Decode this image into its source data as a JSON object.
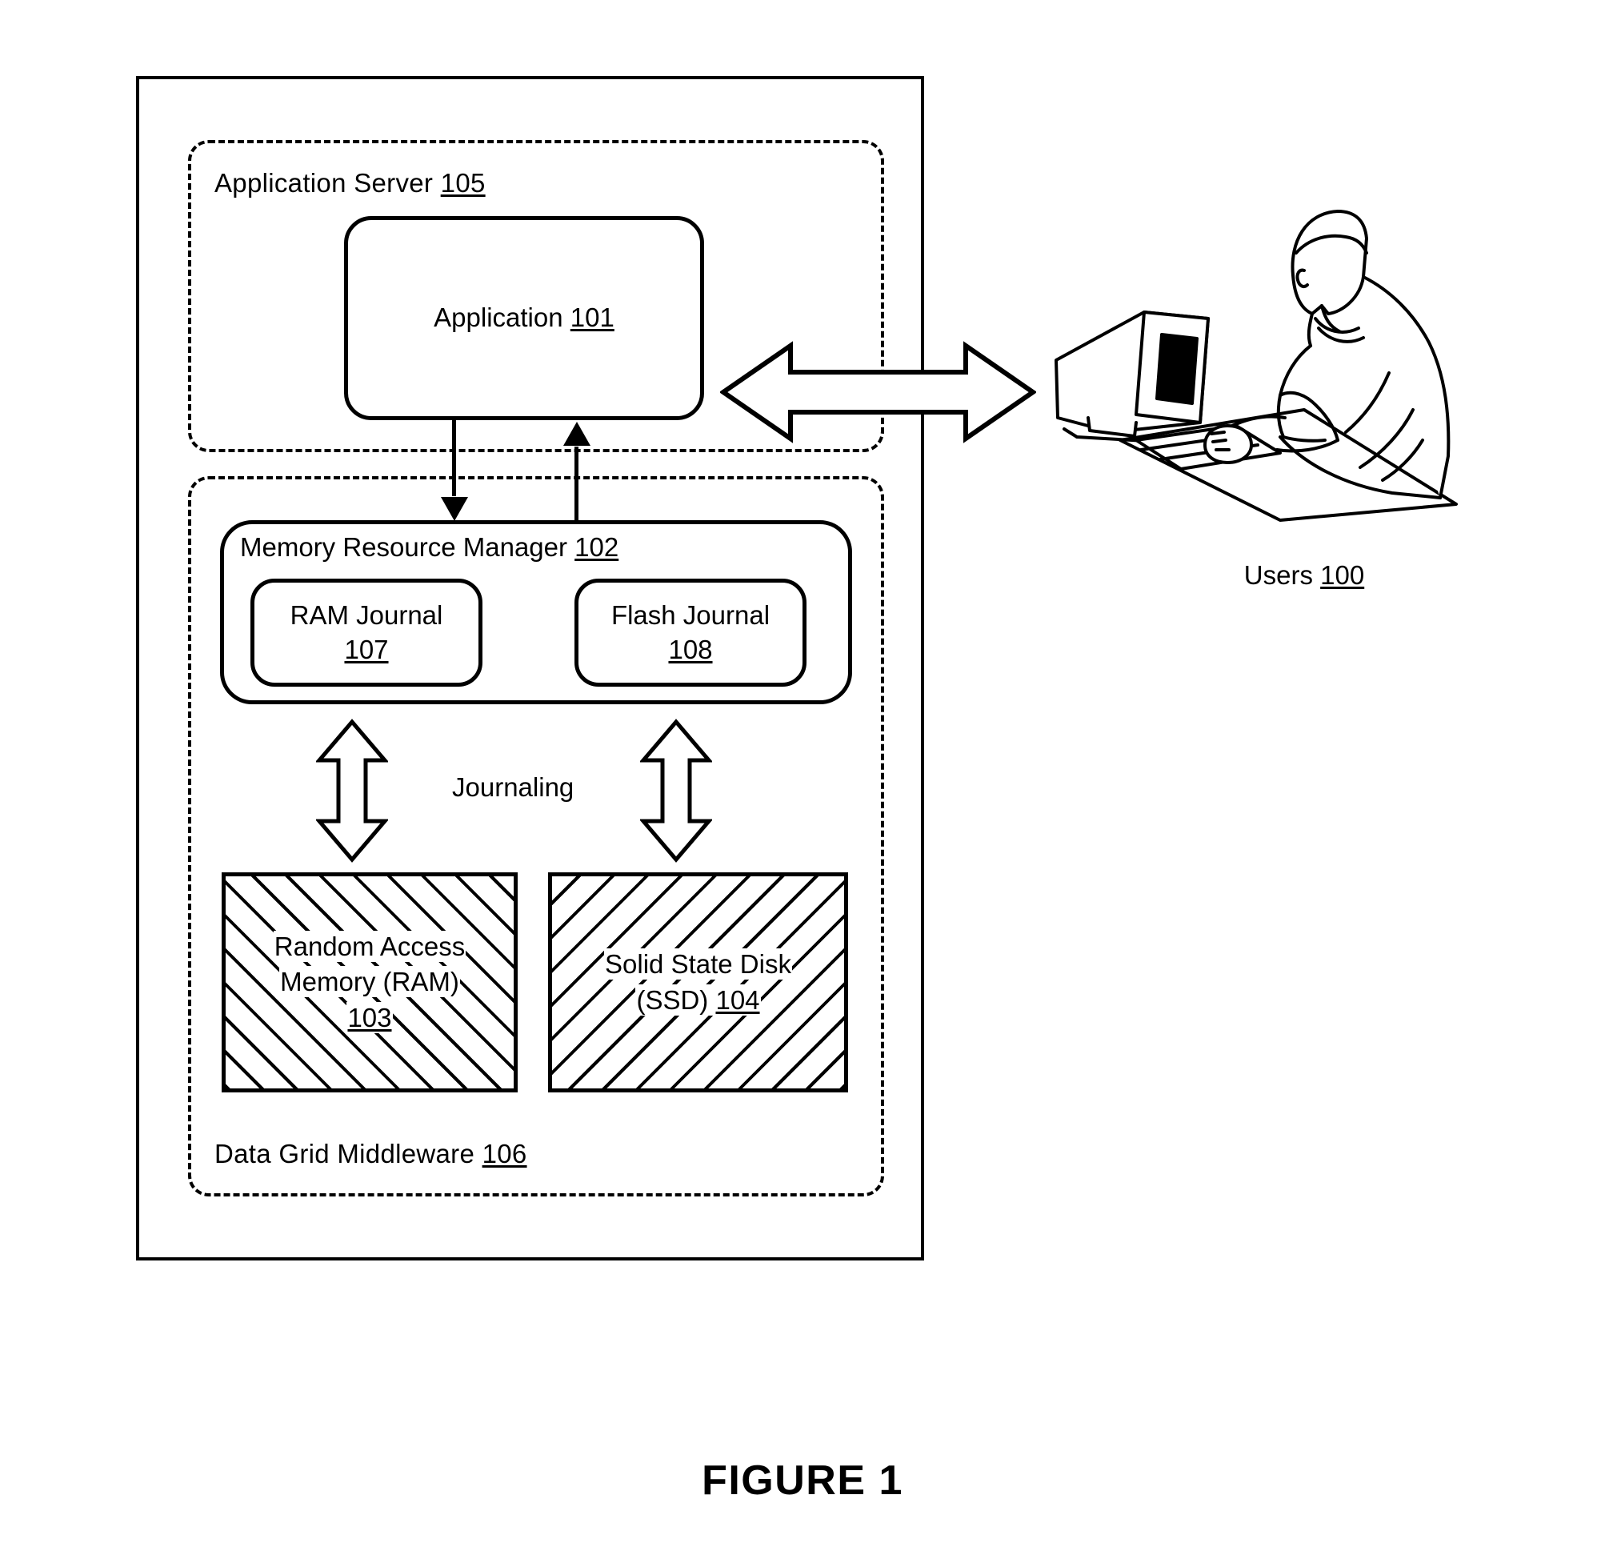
{
  "figure": {
    "caption": "FIGURE 1"
  },
  "application_server": {
    "label_text": "Application Server ",
    "label_ref": "105",
    "application": {
      "label_text": "Application ",
      "label_ref": "101"
    }
  },
  "middleware": {
    "label_text": "Data Grid Middleware ",
    "label_ref": "106",
    "memory_resource_manager": {
      "label_text": "Memory Resource Manager ",
      "label_ref": "102",
      "ram_journal": {
        "line1": "RAM Journal",
        "ref": "107"
      },
      "flash_journal": {
        "line1": "Flash Journal",
        "ref": "108"
      }
    },
    "journaling_label": "Journaling",
    "ram": {
      "line1": "Random Access",
      "line2": "Memory (RAM)",
      "ref": "103"
    },
    "ssd": {
      "line1": "Solid State Disk",
      "line2_text": "(SSD) ",
      "ref": "104"
    }
  },
  "users": {
    "label_text": "Users ",
    "label_ref": "100"
  },
  "colors": {
    "ink": "#000000",
    "paper": "#ffffff"
  }
}
